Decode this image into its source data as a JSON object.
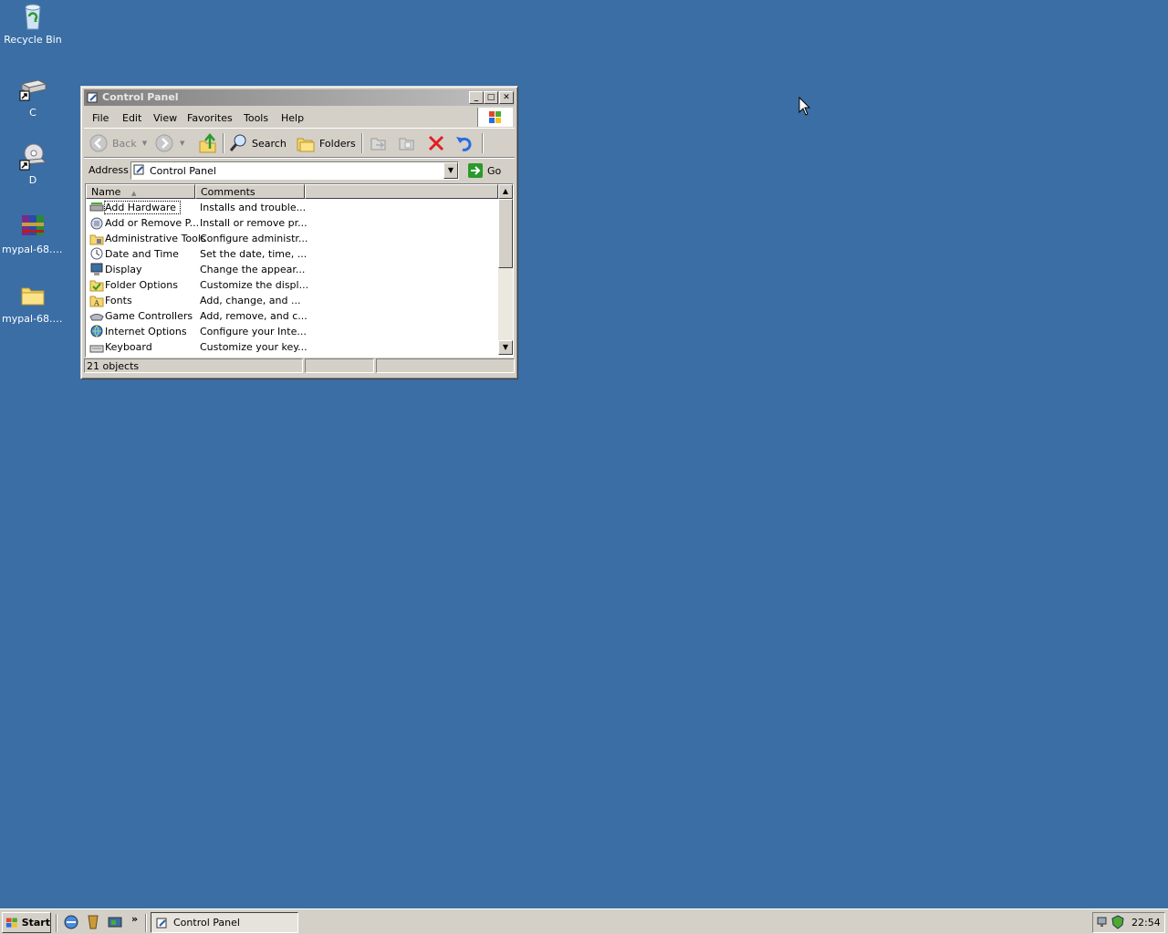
{
  "desktop": {
    "icons": [
      {
        "label": "Recycle Bin",
        "icon": "recycle-bin-icon"
      },
      {
        "label": "C",
        "icon": "drive-shortcut-icon"
      },
      {
        "label": "D",
        "icon": "cd-drive-shortcut-icon"
      },
      {
        "label": "mypal-68.1...",
        "icon": "winrar-archive-icon"
      },
      {
        "label": "mypal-68.1...",
        "icon": "folder-icon"
      }
    ]
  },
  "window": {
    "title": "Control Panel",
    "menu": {
      "file": "File",
      "edit": "Edit",
      "view": "View",
      "favorites": "Favorites",
      "tools": "Tools",
      "help": "Help"
    },
    "toolbar": {
      "back": "Back",
      "search": "Search",
      "folders": "Folders"
    },
    "address": {
      "label": "Address",
      "value": "Control Panel",
      "go": "Go"
    },
    "columns": {
      "name": "Name",
      "comments": "Comments"
    },
    "items": [
      {
        "name": "Add Hardware",
        "comment": "Installs and trouble..."
      },
      {
        "name": "Add or Remove P...",
        "comment": "Install or remove pr..."
      },
      {
        "name": "Administrative Tools",
        "comment": "Configure administr..."
      },
      {
        "name": "Date and Time",
        "comment": "Set the date, time, ..."
      },
      {
        "name": "Display",
        "comment": "Change the appear..."
      },
      {
        "name": "Folder Options",
        "comment": "Customize the displ..."
      },
      {
        "name": "Fonts",
        "comment": "Add, change, and ..."
      },
      {
        "name": "Game Controllers",
        "comment": "Add, remove, and c..."
      },
      {
        "name": "Internet Options",
        "comment": "Configure your Inte..."
      },
      {
        "name": "Keyboard",
        "comment": "Customize your key..."
      }
    ],
    "status": "21 objects"
  },
  "taskbar": {
    "start": "Start",
    "chevron": "»",
    "task": "Control Panel",
    "clock": "22:54"
  },
  "colors": {
    "desktop": "#3a6ea5",
    "chrome": "#d4d0c8"
  }
}
